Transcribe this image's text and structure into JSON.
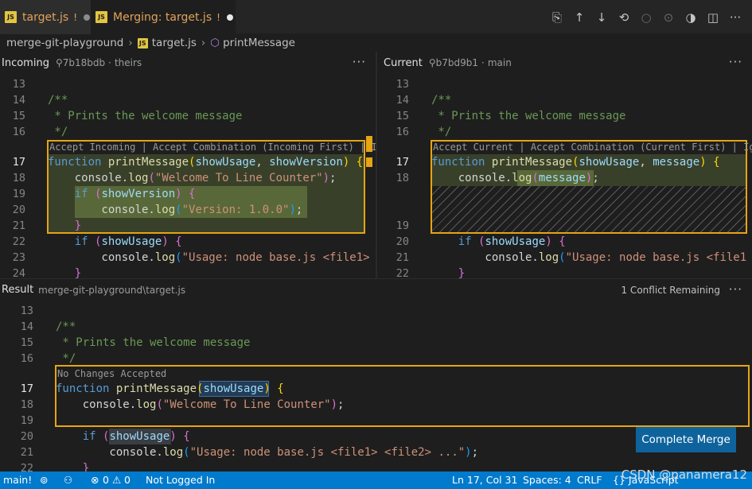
{
  "tabs": [
    {
      "label": "target.js",
      "marker": "!"
    },
    {
      "label": "Merging: target.js",
      "marker": "!"
    }
  ],
  "toolbar": {
    "icons": [
      "open-file-icon",
      "arrow-up-icon",
      "arrow-down-icon",
      "accept-icon",
      "circle-icon",
      "circle-arrow-icon",
      "toggle-icon",
      "split-editor-icon",
      "more-icon"
    ]
  },
  "breadcrumb": {
    "folder": "merge-git-playground",
    "file": "target.js",
    "symbol": "printMessage"
  },
  "incoming": {
    "title": "Incoming",
    "commit": "7b18bdb",
    "branch": "theirs",
    "codelens": "Accept Incoming | Accept Combination (Incoming First) | Ignore"
  },
  "current": {
    "title": "Current",
    "commit": "b7bd9b1",
    "branch": "main",
    "codelens": "Accept Current | Accept Combination (Current First) | Ignore"
  },
  "result": {
    "title": "Result",
    "path": "merge-git-playground\\target.js",
    "conflicts": "1 Conflict Remaining",
    "codelens": "No Changes Accepted",
    "complete_button": "Complete Merge"
  },
  "status": {
    "branch": "main!",
    "errors": "0",
    "warnings": "0",
    "login": "Not Logged In",
    "position": "Ln 17, Col 31",
    "spaces": "Spaces: 4",
    "eol": "CRLF",
    "language": "{} JavaScript"
  },
  "watermark": "CSDN @panamera12",
  "more_glyph": "···"
}
